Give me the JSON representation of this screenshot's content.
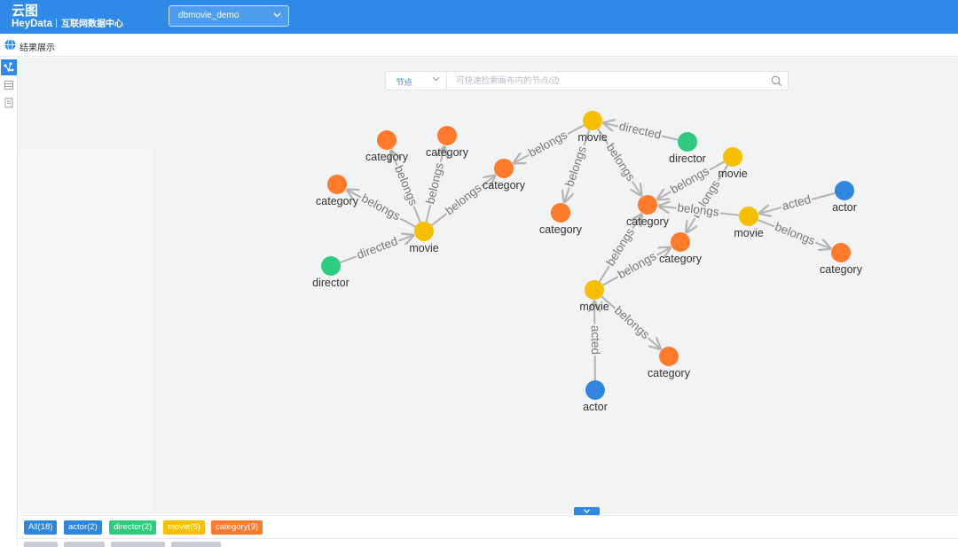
{
  "header": {
    "app_title": "云图",
    "brand": "HeyData",
    "subtitle": "互联网数据中心",
    "database_selected": "dbmovie_demo"
  },
  "subheader": {
    "title": "结果展示"
  },
  "search": {
    "type_value": "节点",
    "placeholder": "可快速检索画布内的节点/边"
  },
  "colors": {
    "header": "#2f89e6",
    "actor": "#2e86de",
    "director": "#2ecc7f",
    "movie": "#f6c000",
    "category": "#ff7a2a",
    "edge": "#b3b3b3"
  },
  "graph": {
    "nodes": [
      {
        "id": "m1",
        "type": "movie",
        "label": "movie"
      },
      {
        "id": "m2",
        "type": "movie",
        "label": "movie"
      },
      {
        "id": "m3",
        "type": "movie",
        "label": "movie"
      },
      {
        "id": "m4",
        "type": "movie",
        "label": "movie"
      },
      {
        "id": "m5",
        "type": "movie",
        "label": "movie"
      },
      {
        "id": "c1",
        "type": "category",
        "label": "category"
      },
      {
        "id": "c2",
        "type": "category",
        "label": "category"
      },
      {
        "id": "c3",
        "type": "category",
        "label": "category"
      },
      {
        "id": "c4",
        "type": "category",
        "label": "category"
      },
      {
        "id": "c5",
        "type": "category",
        "label": "category"
      },
      {
        "id": "c6",
        "type": "category",
        "label": "category"
      },
      {
        "id": "c7",
        "type": "category",
        "label": "category"
      },
      {
        "id": "c8",
        "type": "category",
        "label": "category"
      },
      {
        "id": "c9",
        "type": "category",
        "label": "category"
      },
      {
        "id": "d1",
        "type": "director",
        "label": "director"
      },
      {
        "id": "d2",
        "type": "director",
        "label": "director"
      },
      {
        "id": "a1",
        "type": "actor",
        "label": "actor"
      },
      {
        "id": "a2",
        "type": "actor",
        "label": "actor"
      }
    ],
    "edges": [
      {
        "from": "m1",
        "to": "c1",
        "label": "belongs"
      },
      {
        "from": "m1",
        "to": "c2",
        "label": "belongs"
      },
      {
        "from": "m1",
        "to": "c3",
        "label": "belongs"
      },
      {
        "from": "m1",
        "to": "c4",
        "label": "belongs"
      },
      {
        "from": "d1",
        "to": "m1",
        "label": "directed"
      },
      {
        "from": "m2",
        "to": "c4",
        "label": "belongs"
      },
      {
        "from": "m2",
        "to": "c5",
        "label": "belongs"
      },
      {
        "from": "m2",
        "to": "c6",
        "label": "belongs"
      },
      {
        "from": "d2",
        "to": "m2",
        "label": "directed"
      },
      {
        "from": "m3",
        "to": "c6",
        "label": "belongs"
      },
      {
        "from": "m3",
        "to": "c7",
        "label": "belongs"
      },
      {
        "from": "m4",
        "to": "c6",
        "label": "belongs"
      },
      {
        "from": "m4",
        "to": "c8",
        "label": "belongs"
      },
      {
        "from": "a1",
        "to": "m4",
        "label": "acted"
      },
      {
        "from": "m5",
        "to": "c6",
        "label": "belongs"
      },
      {
        "from": "m5",
        "to": "c7",
        "label": "belongs"
      },
      {
        "from": "m5",
        "to": "c9",
        "label": "belongs"
      },
      {
        "from": "a2",
        "to": "m5",
        "label": "acted"
      }
    ]
  },
  "legend": [
    {
      "label": "All(18)",
      "color": "#2e86de"
    },
    {
      "label": "actor(2)",
      "color": "#2e86de"
    },
    {
      "label": "director(2)",
      "color": "#2ecc7f"
    },
    {
      "label": "movie(5)",
      "color": "#f6c000"
    },
    {
      "label": "category(9)",
      "color": "#ff7a2a"
    }
  ]
}
